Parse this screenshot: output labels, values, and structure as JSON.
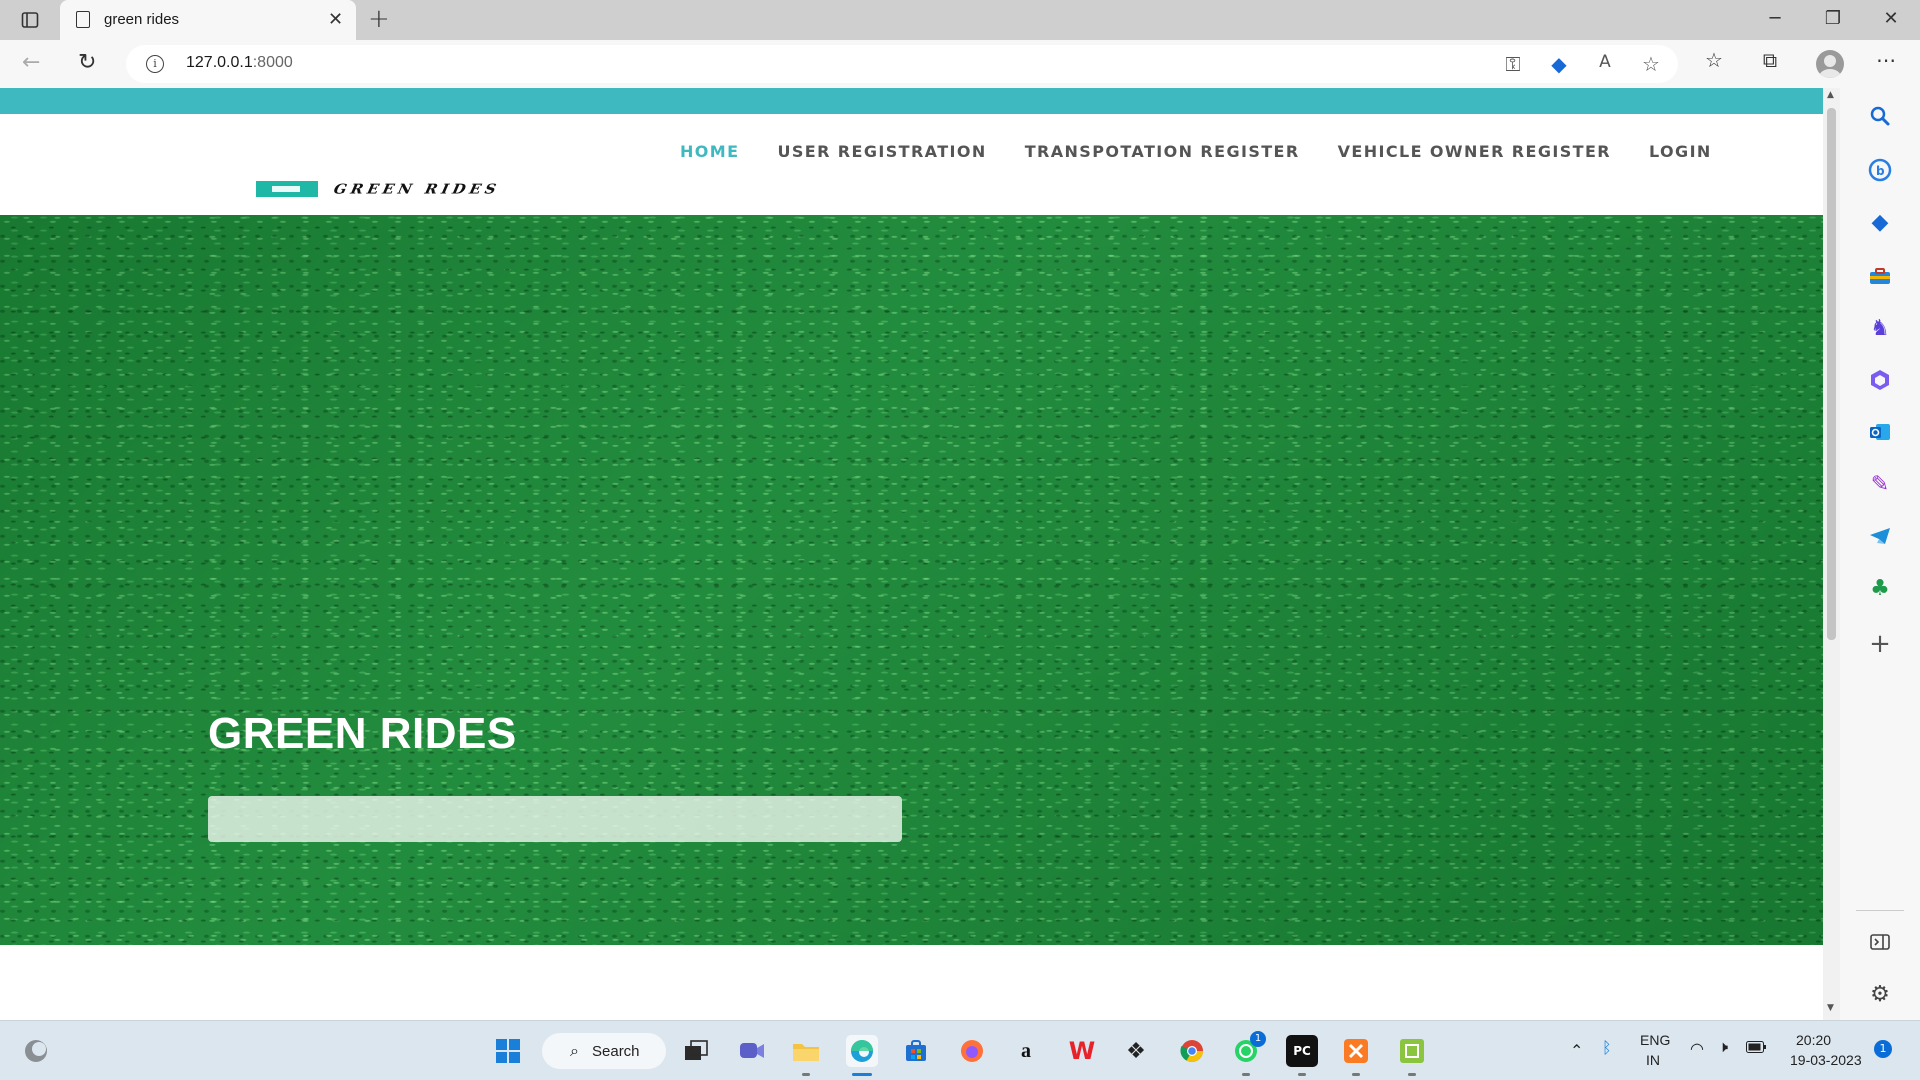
{
  "browser": {
    "tab_title": "green rides",
    "tab_close": "✕",
    "new_tab": "+",
    "url_host": "127.0.0.1",
    "url_port": ":8000",
    "window_min": "─",
    "window_restore": "❐",
    "window_close": "✕"
  },
  "site": {
    "logo_text": "GREEN RIDES",
    "nav": [
      {
        "label": "HOME",
        "active": true
      },
      {
        "label": "USER REGISTRATION"
      },
      {
        "label": "TRANSPOTATION REGISTER"
      },
      {
        "label": "VEHICLE OWNER REGISTER"
      },
      {
        "label": "LOGIN"
      }
    ],
    "hero_title": "GREEN RIDES"
  },
  "colors": {
    "accent_teal": "#3fb9c0",
    "hero_green": "#1e8a3a"
  },
  "taskbar": {
    "search_label": "Search",
    "whatsapp_badge": "1",
    "lang_line1": "ENG",
    "lang_line2": "IN",
    "time": "20:20",
    "date": "19-03-2023",
    "notifications": "1"
  },
  "icons": {
    "sidebar": [
      "search-icon",
      "bing-chat-icon",
      "shopping-tag-icon",
      "tools-icon",
      "games-icon",
      "microsoft365-icon",
      "outlook-icon",
      "designer-icon",
      "telegram-icon",
      "tree-icon",
      "add-icon",
      "split-screen-icon",
      "settings-icon"
    ]
  }
}
